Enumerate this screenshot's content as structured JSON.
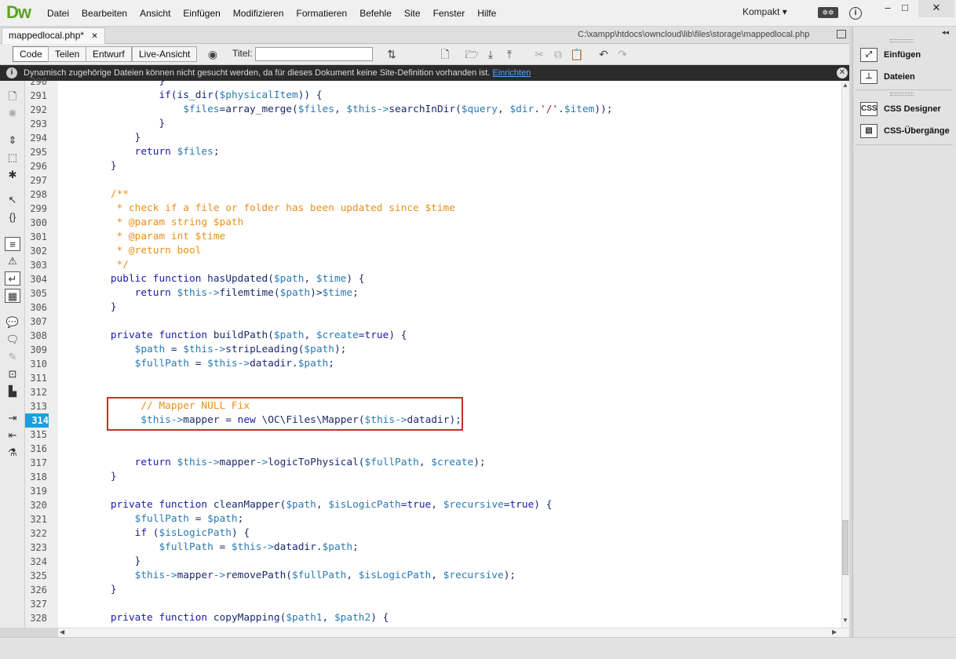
{
  "app": {
    "logo": "Dw",
    "menu": [
      "Datei",
      "Bearbeiten",
      "Ansicht",
      "Einfügen",
      "Modifizieren",
      "Formatieren",
      "Befehle",
      "Site",
      "Fenster",
      "Hilfe"
    ],
    "workspace": "Kompakt",
    "window_buttons": [
      "–",
      "□",
      "✕"
    ]
  },
  "tabs": {
    "doc_tab": "mappedlocal.php*",
    "doc_tab_close": "✕",
    "file_path": "C:\\xampp\\htdocs\\owncloud\\lib\\files\\storage\\mappedlocal.php"
  },
  "toolbar": {
    "views": [
      "Code",
      "Teilen",
      "Entwurf",
      "Live-Ansicht"
    ],
    "active_view": "Code",
    "title_label": "Titel:",
    "title_value": ""
  },
  "infobar": {
    "icon": "i",
    "message": "Dynamisch zugehörige Dateien können nicht gesucht werden, da für dieses Dokument keine Site-Definition vorhanden ist.",
    "link": "Einrichten",
    "close": "✕"
  },
  "editor": {
    "current_line": "314",
    "lines": [
      {
        "n": "290",
        "code": "            }"
      },
      {
        "n": "291",
        "code": "            if(is_dir($physicalItem)) {"
      },
      {
        "n": "292",
        "code": "                $files=array_merge($files, $this->searchInDir($query, $dir.'/'.$item));"
      },
      {
        "n": "293",
        "code": "            }"
      },
      {
        "n": "294",
        "code": "        }"
      },
      {
        "n": "295",
        "code": "        return $files;"
      },
      {
        "n": "296",
        "code": "    }"
      },
      {
        "n": "297",
        "code": ""
      },
      {
        "n": "298",
        "code": "    /**"
      },
      {
        "n": "299",
        "code": "     * check if a file or folder has been updated since $time"
      },
      {
        "n": "300",
        "code": "     * @param string $path"
      },
      {
        "n": "301",
        "code": "     * @param int $time"
      },
      {
        "n": "302",
        "code": "     * @return bool"
      },
      {
        "n": "303",
        "code": "     */"
      },
      {
        "n": "304",
        "code": "    public function hasUpdated($path, $time) {"
      },
      {
        "n": "305",
        "code": "        return $this->filemtime($path)>$time;"
      },
      {
        "n": "306",
        "code": "    }"
      },
      {
        "n": "307",
        "code": ""
      },
      {
        "n": "308",
        "code": "    private function buildPath($path, $create=true) {"
      },
      {
        "n": "309",
        "code": "        $path = $this->stripLeading($path);"
      },
      {
        "n": "310",
        "code": "        $fullPath = $this->datadir.$path;"
      },
      {
        "n": "311",
        "code": ""
      },
      {
        "n": "312",
        "code": ""
      },
      {
        "n": "313",
        "code": "         // Mapper NULL Fix"
      },
      {
        "n": "314",
        "code": "         $this->mapper = new \\OC\\Files\\Mapper($this->datadir);"
      },
      {
        "n": "315",
        "code": ""
      },
      {
        "n": "316",
        "code": ""
      },
      {
        "n": "317",
        "code": "        return $this->mapper->logicToPhysical($fullPath, $create);"
      },
      {
        "n": "318",
        "code": "    }"
      },
      {
        "n": "319",
        "code": ""
      },
      {
        "n": "320",
        "code": "    private function cleanMapper($path, $isLogicPath=true, $recursive=true) {"
      },
      {
        "n": "321",
        "code": "        $fullPath = $path;"
      },
      {
        "n": "322",
        "code": "        if ($isLogicPath) {"
      },
      {
        "n": "323",
        "code": "            $fullPath = $this->datadir.$path;"
      },
      {
        "n": "324",
        "code": "        }"
      },
      {
        "n": "325",
        "code": "        $this->mapper->removePath($fullPath, $isLogicPath, $recursive);"
      },
      {
        "n": "326",
        "code": "    }"
      },
      {
        "n": "327",
        "code": ""
      },
      {
        "n": "328",
        "code": "    private function copyMapping($path1, $path2) {"
      }
    ]
  },
  "right_panel": {
    "items": [
      {
        "label": "Einfügen",
        "icon": "insert-icon"
      },
      {
        "label": "Dateien",
        "icon": "files-tree-icon"
      },
      {
        "label": "CSS Designer",
        "icon": "css-designer-icon"
      },
      {
        "label": "CSS-Übergänge",
        "icon": "css-transitions-icon"
      }
    ],
    "collapse": "◂◂"
  },
  "colors": {
    "keyword": "#1a1aa6",
    "variable": "#2a7ab0",
    "comment": "#e8901a",
    "string": "#b8213b",
    "current_line_bg": "#1a9fe0",
    "highlight_box": "#d22a2a"
  }
}
